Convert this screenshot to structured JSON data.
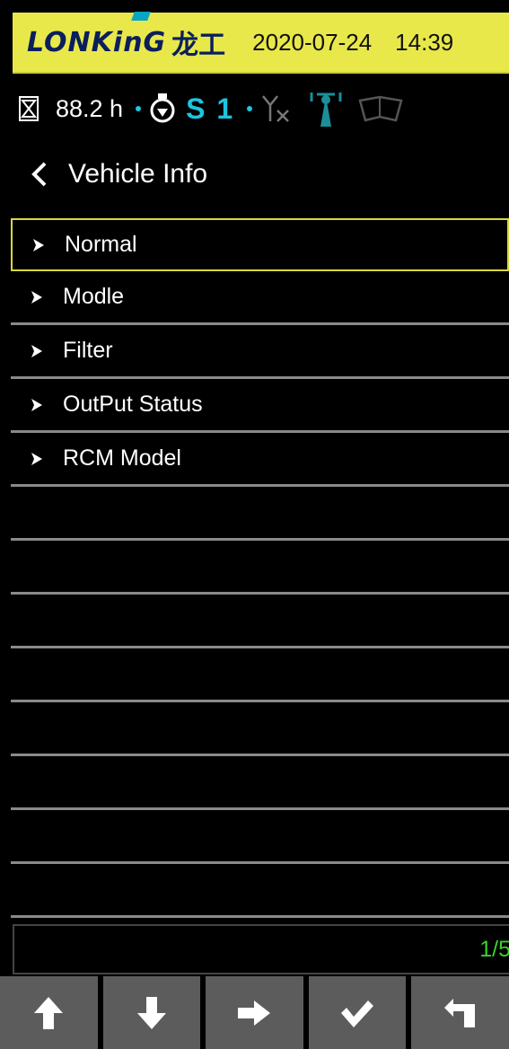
{
  "header": {
    "brand": "LONKinG",
    "brand_cn": "龙工",
    "date": "2020-07-24",
    "time": "14:39",
    "background_color": "#e8e84a",
    "brand_color": "#0b1f5c"
  },
  "status": {
    "hour_meter": "88.2 h",
    "gear": "S 1",
    "accent_color": "#1bc6e0",
    "icons": [
      "hourglass-icon",
      "engine-gear-icon",
      "no-signal-antenna-icon",
      "signal-tower-icon",
      "manual-book-icon"
    ]
  },
  "page": {
    "title": "Vehicle Info"
  },
  "menu": {
    "items": [
      {
        "label": "Normal",
        "selected": true
      },
      {
        "label": "Modle"
      },
      {
        "label": "Filter"
      },
      {
        "label": "OutPut Status"
      },
      {
        "label": "RCM Model"
      },
      {
        "label": ""
      },
      {
        "label": ""
      },
      {
        "label": ""
      },
      {
        "label": ""
      },
      {
        "label": ""
      },
      {
        "label": ""
      },
      {
        "label": ""
      },
      {
        "label": ""
      }
    ]
  },
  "pager": {
    "text": "1/5",
    "color": "#39d32b"
  },
  "softkeys": [
    {
      "icon": "arrow-up-icon"
    },
    {
      "icon": "arrow-down-icon"
    },
    {
      "icon": "arrow-right-icon"
    },
    {
      "icon": "check-icon"
    },
    {
      "icon": "return-icon"
    }
  ]
}
